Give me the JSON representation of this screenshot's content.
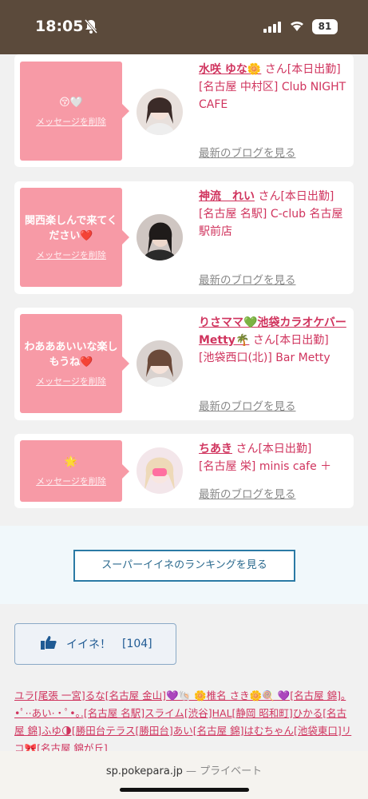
{
  "status": {
    "time": "18:05",
    "battery": "81"
  },
  "cards": [
    {
      "msg": "😚🤍",
      "delete": "メッセージを削除",
      "name": "水咲 ゆな🌼",
      "san": "さん[本日出勤]",
      "shop": "[名古屋 中村区] Club NIGHT CAFE",
      "blog": "最新のブログを見る"
    },
    {
      "msg": "関西楽しんで来てください❤️",
      "delete": "メッセージを削除",
      "name": "神流　れい",
      "san": "さん[本日出勤]",
      "shop": "[名古屋 名駅] C-club 名古屋駅前店",
      "blog": "最新のブログを見る"
    },
    {
      "msg": "わあああいいな楽しもうね❤️",
      "delete": "メッセージを削除",
      "name": "りさママ💚池袋カラオケバーMetty🌴",
      "san": "さん[本日出勤]",
      "shop": "[池袋西口(北)] Bar Metty",
      "blog": "最新のブログを見る"
    },
    {
      "msg": "🌟",
      "delete": "メッセージを削除",
      "name": "ちあき",
      "san": "さん[本日出勤]",
      "shop": "[名古屋 栄] minis cafe ＋",
      "blog": "最新のブログを見る"
    }
  ],
  "ranking_button": "スーパーイイネのランキングを見る",
  "iine": {
    "label": "イイネ！",
    "count": "[104]"
  },
  "links_text": "ユラ[尾張 一宮]るな[名古屋 金山]💜🐚 🌼椎名 さき🌼🍭 💜[名古屋 錦]｡•ﾟ··あい··ﾟ•｡.[名古屋 名駅]スライム[渋谷]HAL[静岡 昭和町]ひかる[名古屋 錦]ふゆ🌗[勝田台テラス[勝田台]あい[名古屋 錦]はむちゃん[池袋東口]リコ🎀[名古屋 錦が丘]",
  "url": {
    "domain": "sp.pokepara.jp",
    "suffix": "— プライベート"
  }
}
